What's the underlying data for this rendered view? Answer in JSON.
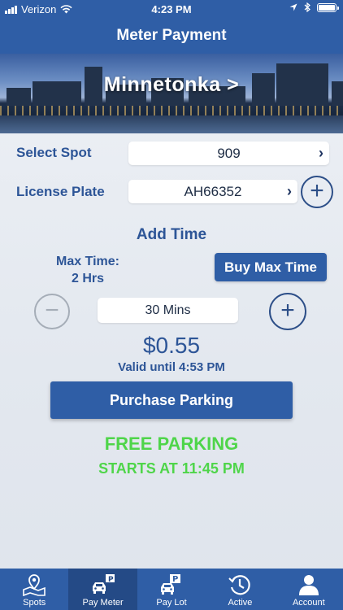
{
  "status_bar": {
    "carrier": "Verizon",
    "time": "4:23 PM"
  },
  "nav": {
    "title": "Meter Payment"
  },
  "banner": {
    "city": "Minnetonka >"
  },
  "form": {
    "spot_label": "Select Spot",
    "spot_value": "909",
    "plate_label": "License Plate",
    "plate_value": "AH66352",
    "chevron": "›",
    "add_glyph": "+"
  },
  "time_section": {
    "heading": "Add Time",
    "max_time_label": "Max Time:",
    "max_time_value": "2 Hrs",
    "buy_max_label": "Buy Max Time",
    "minus_glyph": "−",
    "plus_glyph": "+",
    "duration": "30 Mins"
  },
  "summary": {
    "price": "$0.55",
    "valid_until": "Valid until 4:53 PM",
    "purchase_label": "Purchase Parking"
  },
  "notice": {
    "free": "FREE PARKING",
    "starts": "STARTS AT 11:45 PM"
  },
  "tabs": [
    {
      "label": "Spots",
      "icon": "map-pin-icon",
      "active": false
    },
    {
      "label": "Pay Meter",
      "icon": "car-meter-icon",
      "active": true
    },
    {
      "label": "Pay Lot",
      "icon": "car-lot-icon",
      "active": false
    },
    {
      "label": "Active",
      "icon": "clock-history-icon",
      "active": false
    },
    {
      "label": "Account",
      "icon": "person-icon",
      "active": false
    }
  ],
  "colors": {
    "brand_blue": "#2f5ea6",
    "text_blue": "#2d5597",
    "free_green": "#4fd54a"
  }
}
